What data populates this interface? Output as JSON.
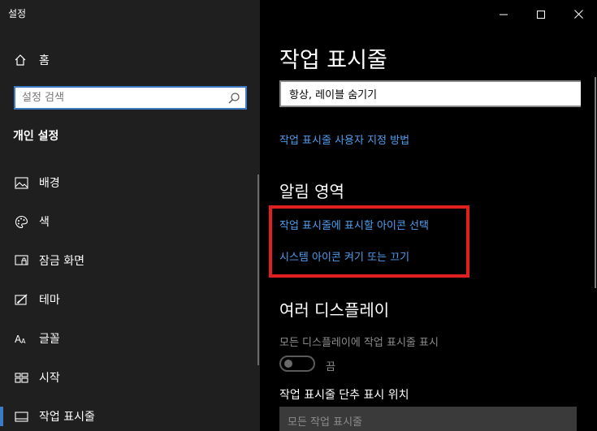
{
  "window": {
    "title": "설정"
  },
  "sidebar": {
    "home_label": "홈",
    "search_placeholder": "설정 검색",
    "section_title": "개인 설정",
    "items": [
      {
        "label": "배경",
        "icon": "image-icon"
      },
      {
        "label": "색",
        "icon": "palette-icon"
      },
      {
        "label": "잠금 화면",
        "icon": "lock-screen-icon"
      },
      {
        "label": "테마",
        "icon": "theme-icon"
      },
      {
        "label": "글꼴",
        "icon": "font-icon"
      },
      {
        "label": "시작",
        "icon": "start-icon"
      },
      {
        "label": "작업 표시줄",
        "icon": "taskbar-icon",
        "active": true
      }
    ]
  },
  "main": {
    "page_title": "작업 표시줄",
    "combine_dropdown_value": "항상, 레이블 숨기기",
    "customize_link": "작업 표시줄 사용자 지정 방법",
    "notification_area_heading": "알림 영역",
    "select_icons_link": "작업 표시줄에 표시할 아이콘 선택",
    "system_icons_link": "시스템 아이콘 켜기 또는 끄기",
    "multi_display_heading": "여러 디스플레이",
    "show_on_all_label": "모든 디스플레이에 작업 표시줄 표시",
    "toggle_state_label": "끔",
    "toggle_on": false,
    "buttons_location_label": "작업 표시줄 단추 표시 위치",
    "buttons_location_value": "모든 작업 표시줄"
  },
  "colors": {
    "accent": "#3d7bc7",
    "link": "#4d9ff0",
    "highlight": "#e02020",
    "sidebar_bg": "#1f1f1f",
    "main_bg": "#000000"
  }
}
